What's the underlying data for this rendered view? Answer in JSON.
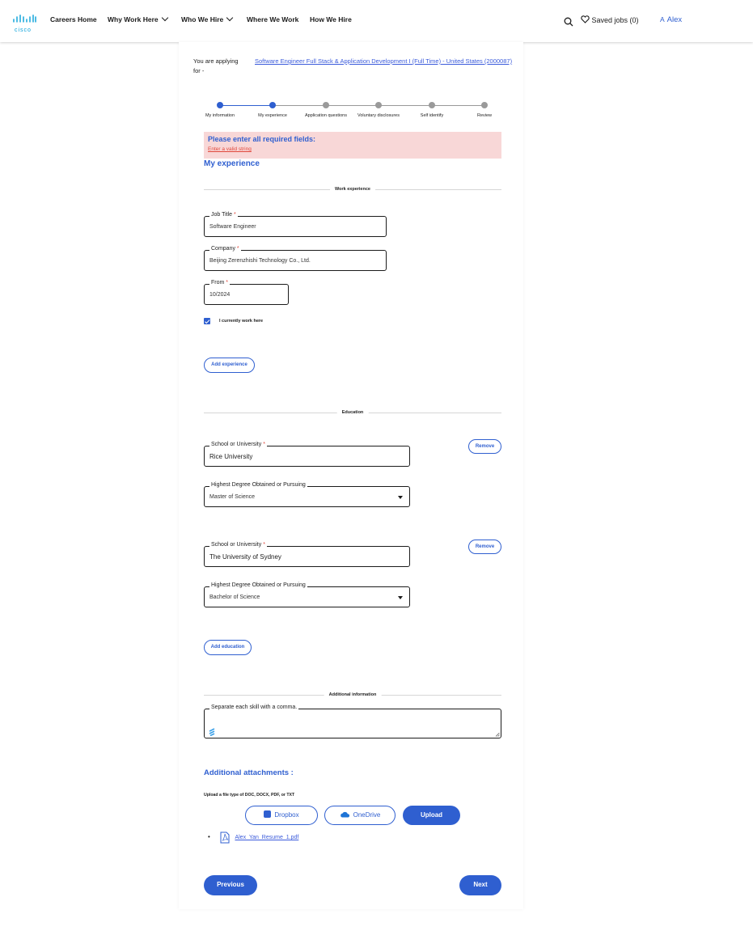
{
  "header": {
    "logo_text": "cisco",
    "nav": [
      {
        "label": "Careers Home"
      },
      {
        "label": "Why Work Here"
      },
      {
        "label": "Who We Hire"
      },
      {
        "label": "Where We Work"
      },
      {
        "label": "How We Hire"
      }
    ],
    "saved_jobs": "Saved jobs (0)",
    "user_initial": "A",
    "user_name": "Alex"
  },
  "applying": {
    "label": "You are applying for -",
    "job_link": "Software Engineer Full Stack & Application Development I (Full Time) - United States (2000087)"
  },
  "stepper": {
    "steps": [
      {
        "label": "My information",
        "state": "complete"
      },
      {
        "label": "My experience",
        "state": "current"
      },
      {
        "label": "Application questions",
        "state": "todo"
      },
      {
        "label": "Voluntary disclosures",
        "state": "todo"
      },
      {
        "label": "Self identify",
        "state": "todo"
      },
      {
        "label": "Review",
        "state": "todo"
      }
    ],
    "active_color": "#2f5fd0",
    "inactive_color": "#9a9a9a"
  },
  "alert": {
    "title": "Please enter all required fields:",
    "link": "Enter a valid string",
    "background": "#f8d7d7"
  },
  "section_title": "My experience",
  "work": {
    "divider": "Work experience",
    "job_title_label": "Job Title",
    "job_title_value": "Software Engineer",
    "company_label": "Company",
    "company_value": "Beijing Zerenzhishi Technology Co., Ltd.",
    "from_label": "From",
    "from_value": "10/2024",
    "required_mark": "*",
    "current_checkbox_label": "I currently work here",
    "current_checked": true,
    "add_button": "Add experience"
  },
  "education": {
    "divider": "Education",
    "entries": [
      {
        "school_label": "School or University",
        "school_value": "Rice University",
        "degree_label": "Highest Degree Obtained or Pursuing",
        "degree_value": "Master of Science",
        "remove": "Remove"
      },
      {
        "school_label": "School or University",
        "school_value": "The University of Sydney",
        "degree_label": "Highest Degree Obtained or Pursuing",
        "degree_value": "Bachelor of Science",
        "remove": "Remove"
      }
    ],
    "add_button": "Add education"
  },
  "additional": {
    "divider": "Additional information",
    "skills_label": "Separate each skill with a comma."
  },
  "attachments": {
    "title": "Additional attachments :",
    "hint": "Upload a file type of DOC, DOCX, PDF, or TXT",
    "dropbox": "Dropbox",
    "onedrive": "OneDrive",
    "upload": "Upload",
    "files": [
      "Alex_Yan_Resume_1.pdf"
    ]
  },
  "footer": {
    "previous": "Previous",
    "next": "Next"
  },
  "colors": {
    "accent": "#2f5fd0",
    "error": "#e0483c",
    "cisco_blue": "#049fd9"
  }
}
